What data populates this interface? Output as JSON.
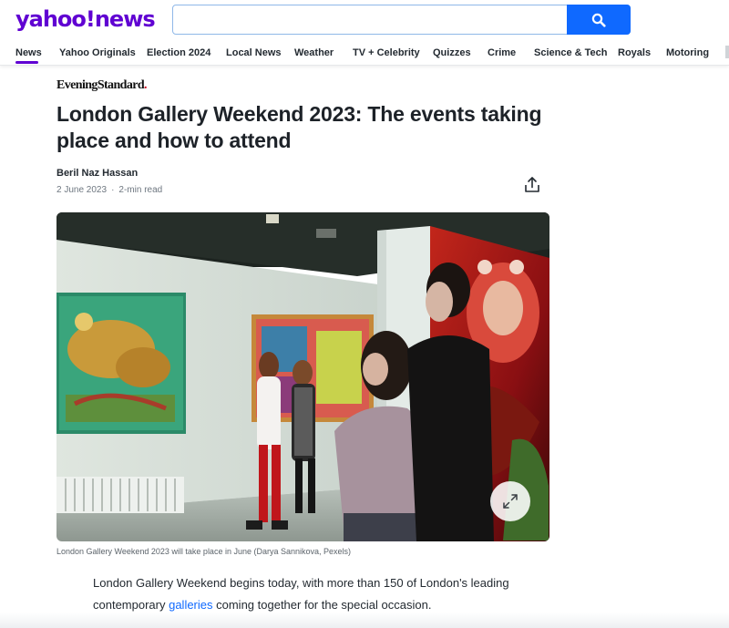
{
  "header": {
    "logo": "yahoo!news",
    "search": {
      "value": "",
      "placeholder": ""
    },
    "nav": [
      {
        "label": "News",
        "active": true
      },
      {
        "label": "Yahoo Originals"
      },
      {
        "label": "Election 2024"
      },
      {
        "label": "Local News"
      },
      {
        "label": "Weather"
      },
      {
        "label": "TV + Celebrity"
      },
      {
        "label": "Quizzes"
      },
      {
        "label": "Crime"
      },
      {
        "label": "Science & Tech"
      },
      {
        "label": "Royals"
      },
      {
        "label": "Motoring"
      }
    ]
  },
  "article": {
    "publisher": "EveningStandard",
    "publisher_dot": ".",
    "headline": "London Gallery Weekend 2023: The events taking place and how to attend",
    "author": "Beril Naz Hassan",
    "date": "2 June 2023",
    "separator": "·",
    "read_time": "2-min read",
    "caption": "London Gallery Weekend 2023 will take place in June (Darya Sannikova, Pexels)",
    "body_part1": "London Gallery Weekend begins today, with more than 150 of London's leading contemporary ",
    "body_link": "galleries",
    "body_part2": " coming together for the special occasion."
  },
  "colors": {
    "brand_purple": "#6001d2",
    "search_blue": "#0f69ff",
    "link_blue": "#0f69ff",
    "standard_red": "#d0021b"
  },
  "icons": {
    "search": "search-icon",
    "share": "share-icon",
    "expand": "expand-icon"
  }
}
